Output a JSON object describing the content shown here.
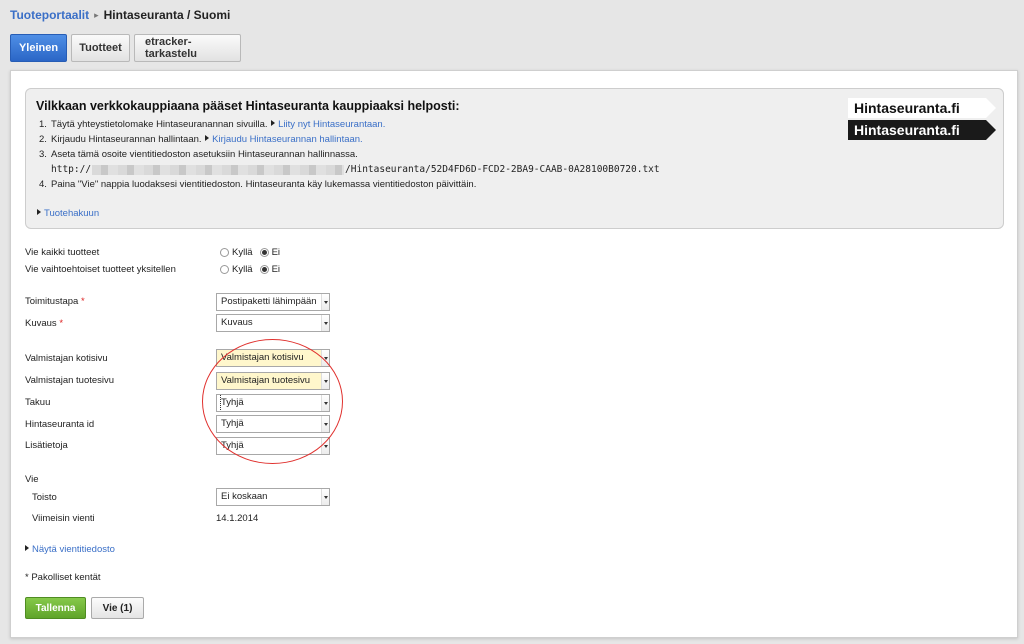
{
  "breadcrumb": {
    "parent": "Tuoteportaalit",
    "current": "Hintaseuranta / Suomi"
  },
  "tabs": [
    {
      "label": "Yleinen",
      "active": true
    },
    {
      "label": "Tuotteet",
      "active": false
    },
    {
      "label": "etracker-tarkastelu",
      "active": false
    }
  ],
  "info": {
    "heading": "Vilkkaan verkkokauppiaana pääset Hintaseuranta kauppiaaksi helposti:",
    "steps": [
      {
        "num": "1.",
        "text": "Täytä yhteystietolomake Hintaseuranannan sivuilla.",
        "link": "Liity nyt Hintaseurantaan."
      },
      {
        "num": "2.",
        "text": "Kirjaudu Hintaseurannan hallintaan.",
        "link": "Kirjaudu Hintaseurannan hallintaan."
      },
      {
        "num": "3.",
        "text": "Aseta tämä osoite vientitiedoston asetuksiin Hintaseurannan hallinnassa."
      },
      {
        "num": "4.",
        "text": "Paina \"Vie\" nappia luodaksesi vientitiedoston. Hintaseuranta käy lukemassa vientitiedoston päivittäin."
      }
    ],
    "url_prefix": "http://",
    "url_suffix": "/Hintaseuranta/52D4FD6D-FCD2-2BA9-CAAB-0A28100B0720.txt",
    "product_search_link": "Tuotehakuun",
    "logo_text": "Hintaseuranta.fi"
  },
  "form": {
    "export_all": {
      "label": "Vie kaikki tuotteet",
      "options": [
        "Kyllä",
        "Ei"
      ],
      "selected": "Ei"
    },
    "export_variants": {
      "label": "Vie vaihtoehtoiset tuotteet yksitellen",
      "options": [
        "Kyllä",
        "Ei"
      ],
      "selected": "Ei"
    },
    "delivery": {
      "label": "Toimitustapa",
      "required": "*",
      "value": "Postipaketti lähimpään"
    },
    "description": {
      "label": "Kuvaus",
      "required": "*",
      "value": "Kuvaus"
    },
    "manufacturer_home": {
      "label": "Valmistajan kotisivu",
      "value": "Valmistajan kotisivu"
    },
    "manufacturer_product": {
      "label": "Valmistajan tuotesivu",
      "value": "Valmistajan tuotesivu"
    },
    "warranty": {
      "label": "Takuu",
      "value": "Tyhjä"
    },
    "hintaseuranta_id": {
      "label": "Hintaseuranta id",
      "value": "Tyhjä"
    },
    "additional_info": {
      "label": "Lisätietoja",
      "value": "Tyhjä"
    },
    "export_section": "Vie",
    "repeat": {
      "label": "Toisto",
      "value": "Ei koskaan"
    },
    "last_export": {
      "label": "Viimeisin vienti",
      "value": "14.1.2014"
    },
    "show_export_file": "Näytä vientitiedosto",
    "required_note": "* Pakolliset kentät"
  },
  "buttons": {
    "save": "Tallenna",
    "export": "Vie (1)"
  },
  "colors": {
    "accent_blue": "#2b66c6",
    "save_green": "#5fa42a",
    "highlight_yellow": "#fff7cc",
    "annotation_red": "#e0312e"
  }
}
